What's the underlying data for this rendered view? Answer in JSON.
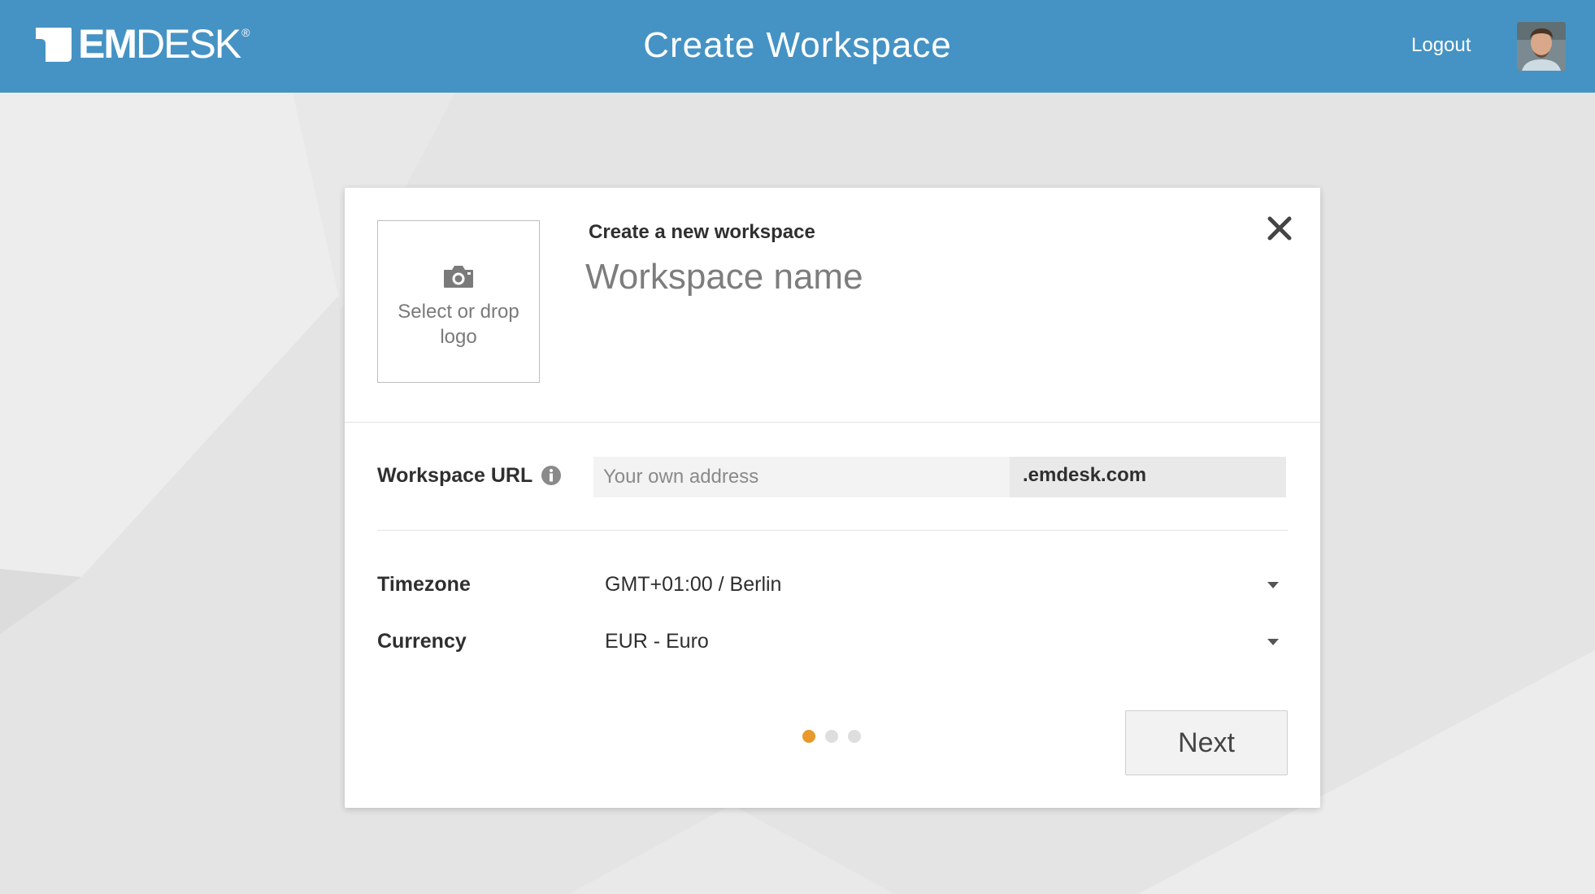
{
  "header": {
    "brand_bold": "EM",
    "brand_light": "DESK",
    "brand_mark": "®",
    "title": "Create Workspace",
    "logout_label": "Logout",
    "avatar_icon": "user-avatar"
  },
  "colors": {
    "header_bg": "#4593c4",
    "active_dot": "#e8992a",
    "inactive_dot": "#dedede"
  },
  "card": {
    "logo_upload": {
      "icon": "camera-icon",
      "label": "Select or drop logo"
    },
    "subtitle": "Create a new workspace",
    "workspace_name": {
      "value": "",
      "placeholder": "Workspace name"
    },
    "close_icon": "close-icon",
    "url": {
      "label": "Workspace URL",
      "info_icon": "info-icon",
      "value": "",
      "placeholder": "Your own address",
      "suffix": ".emdesk.com"
    },
    "timezone": {
      "label": "Timezone",
      "value": "GMT+01:00 / Berlin"
    },
    "currency": {
      "label": "Currency",
      "value": "EUR - Euro"
    },
    "steps": {
      "current": 1,
      "total": 3
    },
    "next_label": "Next"
  }
}
